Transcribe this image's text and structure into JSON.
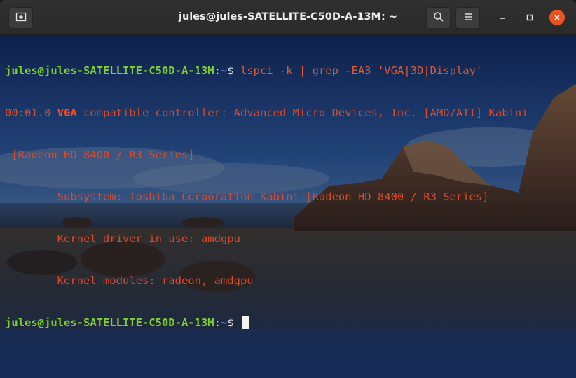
{
  "window": {
    "title": "jules@jules-SATELLITE-C50D-A-13M: ~",
    "buttons": {
      "new_tab_icon": "new-tab-icon",
      "search_icon": "search-icon",
      "menu_icon": "hamburger-menu-icon",
      "minimize_icon": "minimize-icon",
      "maximize_icon": "maximize-icon",
      "close_icon": "close-icon"
    },
    "close_color": "#e95420"
  },
  "terminal": {
    "prompt": {
      "user_host": "jules@jules-SATELLITE-C50D-A-13M",
      "sep": ":",
      "path": "~",
      "symbol": "$"
    },
    "command": " lspci -k | grep -EA3 'VGA|3D|Display'",
    "output": {
      "line1_prefix": "00:01.0 ",
      "line1_highlight": "VGA",
      "line1_rest": " compatible controller: Advanced Micro Devices, Inc. [AMD/ATI] Kabini",
      "line2": " [Radeon HD 8400 / R3 Series]",
      "line3": "        Subsystem: Toshiba Corporation Kabini [Radeon HD 8400 / R3 Series]",
      "line4": "        Kernel driver in use: amdgpu",
      "line5": "        Kernel modules: radeon, amdgpu"
    },
    "colors": {
      "prompt_user": "#7fcf2e",
      "prompt_path": "#5a7fd6",
      "output": "#dd4a28"
    }
  }
}
